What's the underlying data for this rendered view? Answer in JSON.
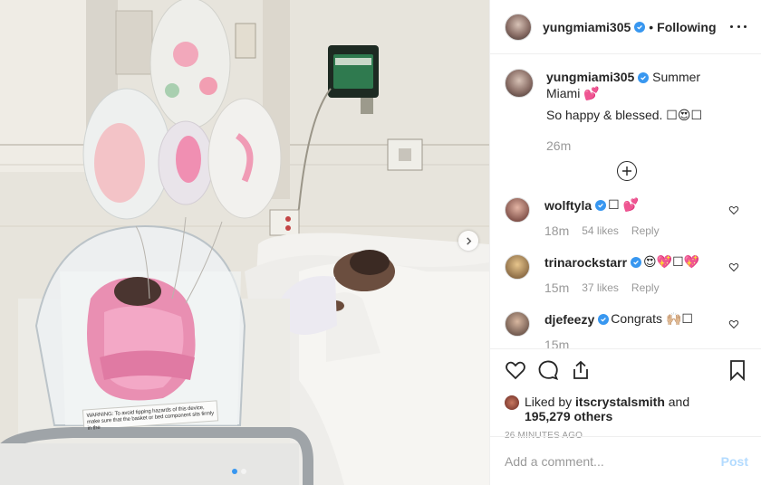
{
  "header": {
    "username": "yungmiami305",
    "separator": "•",
    "follow_status": "Following"
  },
  "caption": {
    "username": "yungmiami305",
    "text_line1": "Summer Miami 💕",
    "text_line2": "So happy & blessed. ☐😍☐",
    "time": "26m"
  },
  "comments": [
    {
      "username": "wolftyla",
      "text": "☐ 💕",
      "time": "18m",
      "likes": "54 likes",
      "reply": "Reply"
    },
    {
      "username": "trinarockstarr",
      "text": "😍💖☐💖",
      "time": "15m",
      "likes": "37 likes",
      "reply": "Reply"
    },
    {
      "username": "djefeezy",
      "text": "Congrats 🙌🏼☐",
      "time": "15m",
      "likes": "",
      "reply": ""
    }
  ],
  "likes": {
    "prefix": "Liked by",
    "user": "itscrystalsmith",
    "and": "and",
    "count": "195,279 others"
  },
  "post_time": "26 MINUTES AGO",
  "add_comment": {
    "placeholder": "Add a comment...",
    "post_label": "Post"
  },
  "photo": {
    "label_text": "WARNING: To avoid tipping hazards of this device, make sure that the basket or bed component sits firmly in the"
  },
  "colors": {
    "verified": "#3897f0",
    "post_disabled": "#b3dbff",
    "muted": "#999999"
  }
}
